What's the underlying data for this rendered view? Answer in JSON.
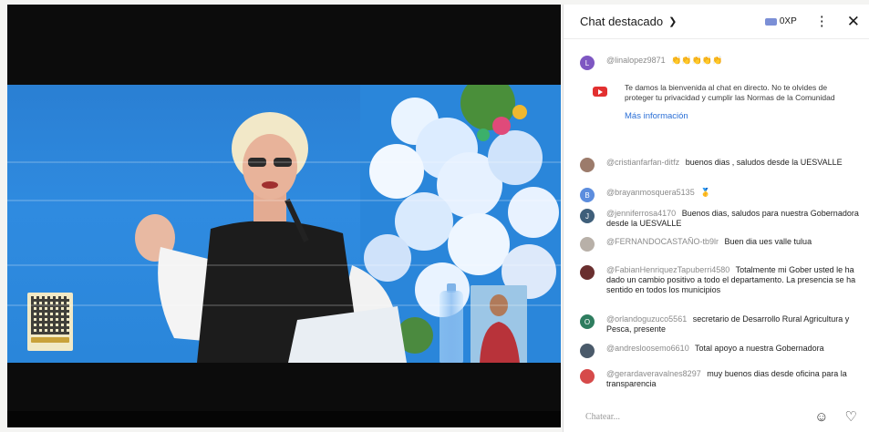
{
  "chat": {
    "title": "Chat destacado",
    "xp": "0XP",
    "input_placeholder": "Chatear...",
    "welcome": {
      "text": "Te damos la bienvenida al chat en directo. No te olvides de proteger tu privacidad y cumplir las Normas de la Comunidad",
      "link": "Más información"
    },
    "messages": [
      {
        "author": "@linalopez9871",
        "text": "👏👏👏👏👏",
        "avatar_letter": "L",
        "avatar_color": "#7e57c2"
      },
      {
        "author": "@cristianfarfan-ditfz",
        "text": "buenos dias , saludos desde la UESVALLE",
        "avatar_letter": "",
        "avatar_color": "#9c7b6b"
      },
      {
        "author": "@brayanmosquera5135",
        "text": "🥇",
        "avatar_letter": "B",
        "avatar_color": "#5c8dde"
      },
      {
        "author": "@jenniferrosa4170",
        "text": "Buenos dias, saludos para nuestra Gobernadora desde la UESVALLE",
        "avatar_letter": "J",
        "avatar_color": "#3f5f7a"
      },
      {
        "author": "@FERNANDOCASTAÑO-tb9lr",
        "text": "Buen dia ues valle tulua",
        "avatar_letter": "",
        "avatar_color": "#b8b0a8"
      },
      {
        "author": "@FabianHenriquezTapuberri4580",
        "text": "Totalmente mi Gober usted le ha dado un cambio positivo a todo el departamento. La presencia se ha sentido en todos los municipios",
        "avatar_letter": "",
        "avatar_color": "#6a2f2f"
      },
      {
        "author": "@orlandoguzuco5561",
        "text": "secretario de Desarrollo Rural Agricultura y Pesca, presente",
        "avatar_letter": "O",
        "avatar_color": "#2e7d5f"
      },
      {
        "author": "@andresloosemo6610",
        "text": "Total apoyo a nuestra Gobernadora",
        "avatar_letter": "",
        "avatar_color": "#4a5a6a"
      },
      {
        "author": "@gerardaveravalnes8297",
        "text": "muy buenos dias desde oficina para la transparencia",
        "avatar_letter": "",
        "avatar_color": "#d64a4a"
      }
    ]
  },
  "icons": {
    "chevron": "chevron-down-icon",
    "xp": "xp-badge-icon",
    "menu": "more-vert-icon",
    "close": "close-icon",
    "emoji": "emoji-icon",
    "heart": "heart-icon",
    "youtube": "youtube-icon"
  },
  "colors": {
    "link": "#2a6fd6",
    "stage_blue": "#2f8be0"
  }
}
